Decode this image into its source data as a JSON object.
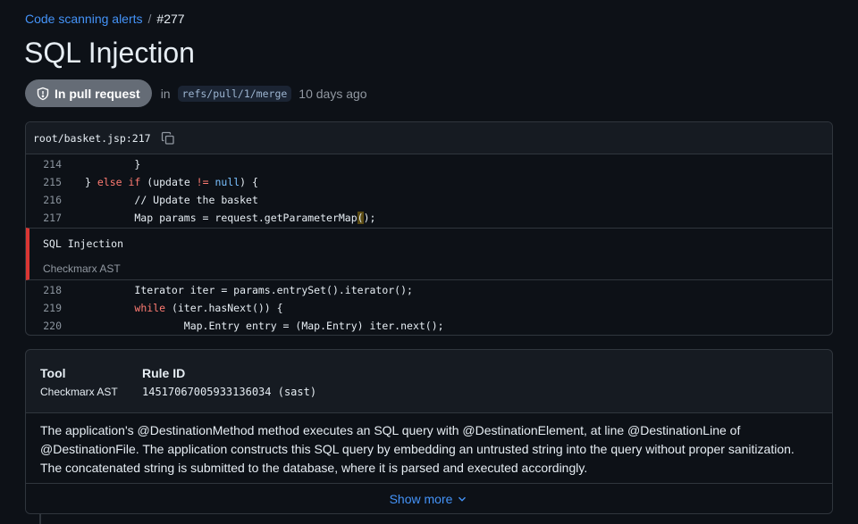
{
  "breadcrumb": {
    "parent": "Code scanning alerts",
    "separator": "/",
    "current": "#277"
  },
  "title": "SQL Injection",
  "status": {
    "state_label": "In pull request",
    "in_text": "in",
    "ref": "refs/pull/1/merge",
    "age": "10 days ago"
  },
  "code": {
    "file_path": "root/basket.jsp:217",
    "lines_before": [
      {
        "num": "214",
        "indent": "        ",
        "text": "}"
      },
      {
        "num": "215",
        "indent": "",
        "text": "} else if (update != null) {"
      },
      {
        "num": "216",
        "indent": "        ",
        "text": "// Update the basket"
      },
      {
        "num": "217",
        "indent": "        ",
        "text": "Map params = request.getParameterMap();"
      }
    ],
    "alert": {
      "title": "SQL Injection",
      "tool": "Checkmarx AST"
    },
    "lines_after": [
      {
        "num": "218",
        "indent": "        ",
        "text": "Iterator iter = params.entrySet().iterator();"
      },
      {
        "num": "219",
        "indent": "        ",
        "text": "while (iter.hasNext()) {"
      },
      {
        "num": "220",
        "indent": "                ",
        "text": "Map.Entry entry = (Map.Entry) iter.next();"
      }
    ]
  },
  "details": {
    "tool_header": "Tool",
    "tool_value": "Checkmarx AST",
    "rule_header": "Rule ID",
    "rule_value": "14517067005933136034 (sast)",
    "description": "The application's @DestinationMethod method executes an SQL query with @DestinationElement, at line @DestinationLine of @DestinationFile. The application constructs this SQL query by embedding an untrusted string into the query without proper sanitization. The concatenated string is submitted to the database, where it is parsed and executed accordingly.",
    "show_more": "Show more"
  },
  "icons": {
    "state": "shield-icon",
    "copy": "copy-icon",
    "chevron": "chevron-down-icon"
  },
  "colors": {
    "link": "#4493f8",
    "alert_border": "#da3633",
    "state_pill": "#656c76"
  }
}
